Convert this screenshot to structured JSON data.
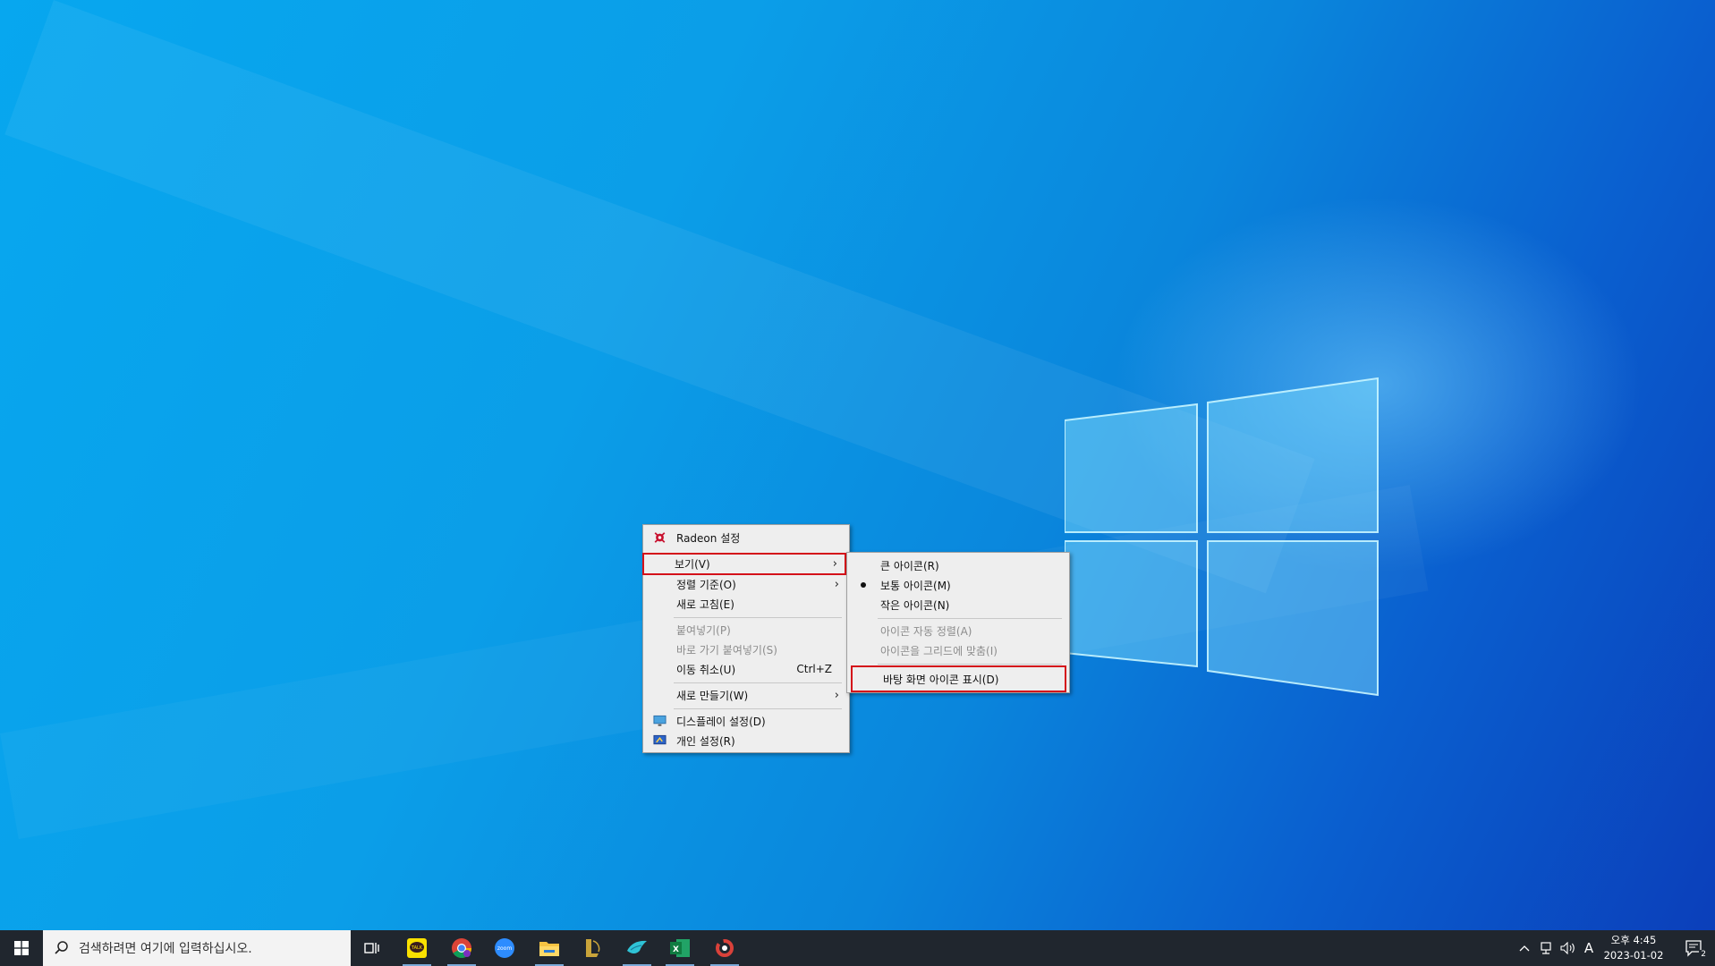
{
  "context_menu": {
    "items": [
      {
        "label": "Radeon 설정",
        "icon": "radeon-icon"
      },
      {
        "label": "보기(V)",
        "submenu": true
      },
      {
        "label": "정렬 기준(O)",
        "submenu": true
      },
      {
        "label": "새로 고침(E)"
      },
      {
        "label": "붙여넣기(P)",
        "disabled": true
      },
      {
        "label": "바로 가기 붙여넣기(S)",
        "disabled": true
      },
      {
        "label": "이동 취소(U)",
        "accel": "Ctrl+Z"
      },
      {
        "label": "새로 만들기(W)",
        "submenu": true
      },
      {
        "label": "디스플레이 설정(D)",
        "icon": "display-icon"
      },
      {
        "label": "개인 설정(R)",
        "icon": "personalize-icon"
      }
    ],
    "arrow": "›"
  },
  "view_submenu": {
    "items": [
      {
        "label": "큰 아이콘(R)"
      },
      {
        "label": "보통 아이콘(M)",
        "selected": true
      },
      {
        "label": "작은 아이콘(N)"
      },
      {
        "label": "아이콘 자동 정렬(A)",
        "disabled": true
      },
      {
        "label": "아이콘을 그리드에 맞춤(I)",
        "disabled": true
      },
      {
        "label": "바탕 화면 아이콘 표시(D)"
      }
    ]
  },
  "taskbar": {
    "search_placeholder": "검색하려면 여기에 입력하십시오.",
    "apps": [
      "task-view-icon",
      "kakaotalk-icon",
      "chrome-icon",
      "zoom-icon",
      "file-explorer-icon",
      "league-icon",
      "bird-app-icon",
      "excel-icon",
      "app-ring-icon"
    ],
    "tray_ime": "A",
    "clock_time": "오후 4:45",
    "clock_date": "2023-01-02",
    "notification_count": "2"
  },
  "colors": {
    "highlight": "#d4111a",
    "menu_bg": "#eeeeee",
    "taskbar_bg": "#20262e"
  }
}
